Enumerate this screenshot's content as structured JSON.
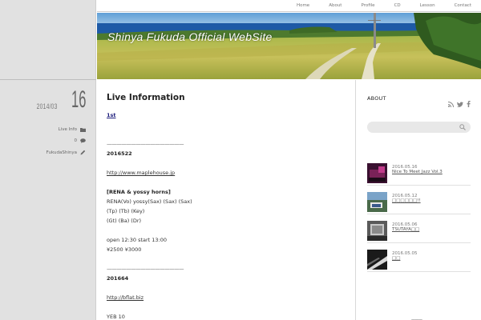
{
  "nav": {
    "items": [
      "Home",
      "About",
      "Profile",
      "CD",
      "Lesson",
      "Contact"
    ]
  },
  "banner": {
    "site_title": "Shinya Fukuda Official WebSite"
  },
  "post_meta": {
    "year_month": "2014/03",
    "day": "16",
    "category": "Live Info",
    "comments": "0",
    "author": "FukudaShinya"
  },
  "post": {
    "title": "Live Information",
    "lines": [
      "1st",
      "",
      "",
      "————————————————",
      "2016522",
      "",
      "http://www.maplehouse.jp",
      "",
      "[RENA & yossy horns]",
      "RENA(Vo) yossy(Sax) (Sax) (Sax)",
      "(Tp) (Tb) (Key)",
      "(Gt) (Ba) (Dr)",
      "",
      "open 12:30 start 13:00",
      "¥2500 ¥3000",
      "",
      "————————————————",
      "201664",
      "",
      "http://bflat.biz",
      "",
      "YEB 10"
    ]
  },
  "sidebar": {
    "about_heading": "ABOUT",
    "search": {
      "placeholder": ""
    },
    "recent_posts": [
      {
        "date": "2016.05.16",
        "title": "Nice To Meet Jazz Vol.3"
      },
      {
        "date": "2016.05.12",
        "title": "□□□□□□!!"
      },
      {
        "date": "2016.05.06",
        "title": "TSUTAYA□□"
      },
      {
        "date": "2016.05.05",
        "title": "□□"
      }
    ],
    "bottom_mark": "———"
  },
  "colors": {
    "sidebar_bg": "#e1e1e1",
    "link_blue": "#1a1a7a",
    "search_bg": "#e8e8e8"
  },
  "icons": [
    "folder-icon",
    "comment-icon",
    "pencil-icon",
    "rss-icon",
    "twitter-icon",
    "facebook-icon",
    "search-icon"
  ]
}
